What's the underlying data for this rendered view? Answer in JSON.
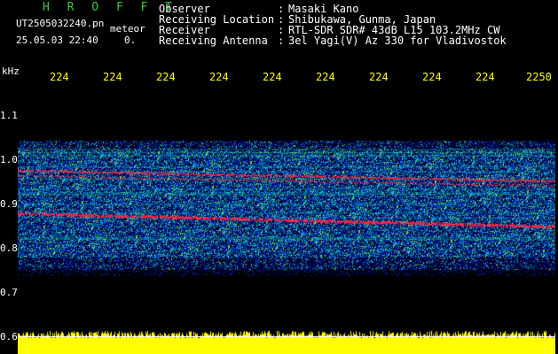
{
  "header": {
    "app_title": "H R O F F T",
    "file_name": "UT2505032240.pn",
    "file_tag": "meteor",
    "datetime": "25.05.03 22:40",
    "counter": "0."
  },
  "info": [
    {
      "label": "Observer",
      "value": "Masaki Kano"
    },
    {
      "label": "Receiving Location",
      "value": "Shibukawa, Gunma, Japan"
    },
    {
      "label": "Receiver",
      "value": "RTL-SDR SDR# 43dB L15 103.2MHz CW"
    },
    {
      "label": "Receiving Antenna",
      "value": "3el Yagi(V) Az 330 for Vladivostok"
    }
  ],
  "axis": {
    "unit": "kHz",
    "freq_ticks": [
      {
        "label": "1.1",
        "value": 1.1
      },
      {
        "label": "1.0",
        "value": 1.0
      },
      {
        "label": "0.9",
        "value": 0.9
      },
      {
        "label": "0.8",
        "value": 0.8
      },
      {
        "label": "0.7",
        "value": 0.7
      },
      {
        "label": "0.6",
        "value": 0.6
      }
    ],
    "time_ticks": [
      "224",
      "224",
      "224",
      "224",
      "224",
      "224",
      "224",
      "224",
      "224",
      "2250"
    ]
  },
  "colors": {
    "header_green": "#33cc33",
    "tick_yellow": "#ffff00",
    "signal_red": "#ff2244",
    "noise_yellow": "#ffff00"
  }
}
